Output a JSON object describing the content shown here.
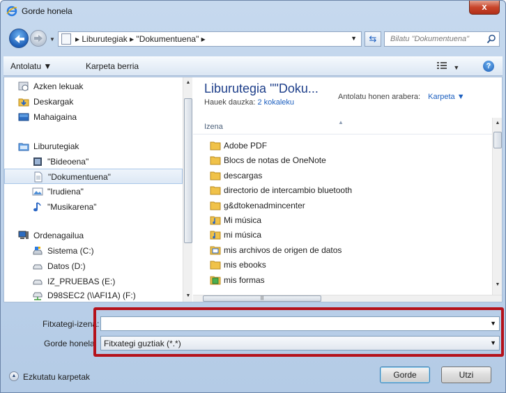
{
  "window": {
    "title": "Gorde honela",
    "close_label": "x"
  },
  "address": {
    "path": "▸ Liburutegiak ▸ \"Dokumentuena\" ▸",
    "search_placeholder": "Bilatu \"Dokumentuena\""
  },
  "toolbar": {
    "organize": "Antolatu ▼",
    "new_folder": "Karpeta berria",
    "help": "?"
  },
  "nav": {
    "favorites": [
      "Azken lekuak",
      "Deskargak",
      "Mahaigaina"
    ],
    "libraries_header": "Liburutegiak",
    "libraries": [
      "\"Bideoena\"",
      "\"Dokumentuena\"",
      "\"Irudiena\"",
      "\"Musikarena\""
    ],
    "computer_header": "Ordenagailua",
    "drives": [
      "Sistema (C:)",
      "Datos (D:)",
      "IZ_PRUEBAS (E:)",
      "D98SEC2 (\\\\AFI1A) (F:)"
    ]
  },
  "content": {
    "library_title": "Liburutegia \"\"Doku...",
    "includes_label": "Hauek dauzka:",
    "includes_link": "2 kokaleku",
    "arrange_label": "Antolatu honen arabera:",
    "arrange_value": "Karpeta ▼",
    "column_name": "Izena",
    "files": [
      "Adobe PDF",
      "Blocs de notas de OneNote",
      "descargas",
      "directorio de intercambio bluetooth",
      "g&dtokenadmincenter",
      "Mi música",
      "mi música",
      "mis archivos de origen de datos",
      "mis ebooks",
      "mis formas"
    ]
  },
  "form": {
    "filename_label": "Fitxategi-izena:",
    "filename_value": "",
    "type_label": "Gorde honela:",
    "type_value": "Fitxategi guztiak (*.*)"
  },
  "footer": {
    "hide_folders": "Ezkutatu karpetak",
    "save": "Gorde",
    "cancel": "Utzi"
  },
  "colors": {
    "highlight_frame": "#b5121b",
    "link": "#1c5fbf",
    "title_blue": "#1e3f8a"
  }
}
